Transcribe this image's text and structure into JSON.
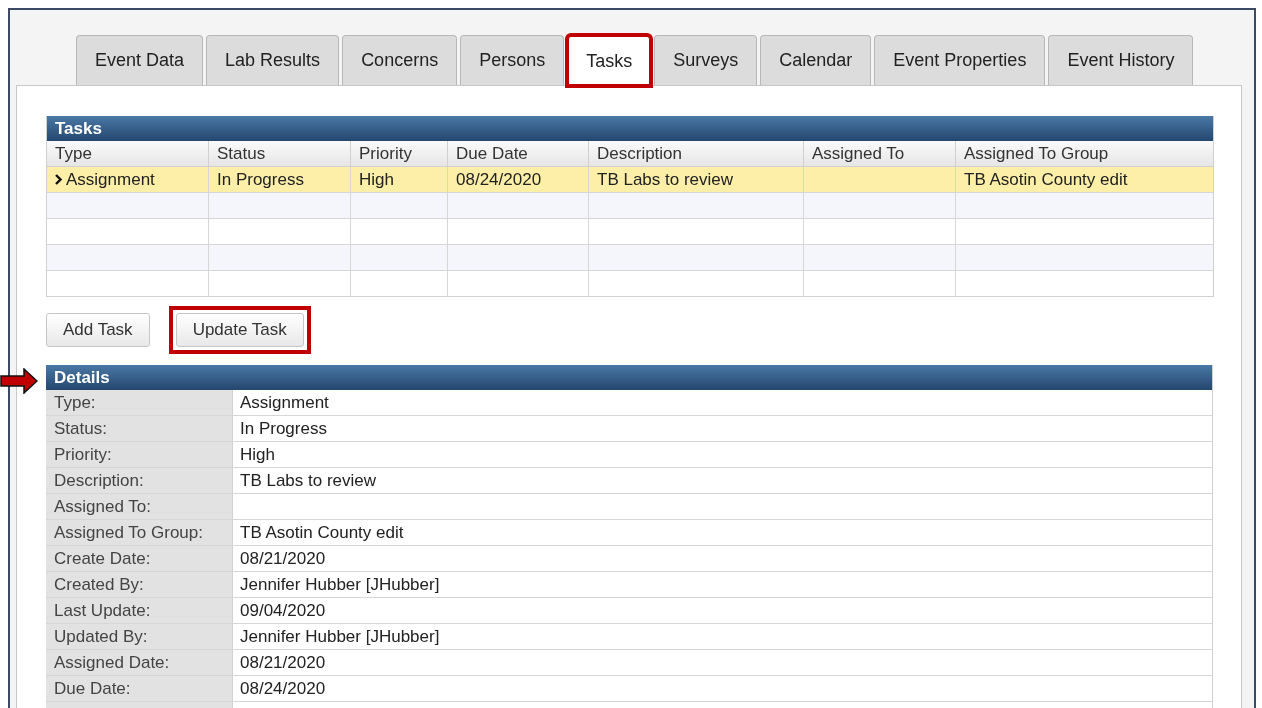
{
  "tabs": [
    {
      "label": "Event Data",
      "selected": false,
      "highlighted": false
    },
    {
      "label": "Lab Results",
      "selected": false,
      "highlighted": false
    },
    {
      "label": "Concerns",
      "selected": false,
      "highlighted": false
    },
    {
      "label": "Persons",
      "selected": false,
      "highlighted": false
    },
    {
      "label": "Tasks",
      "selected": true,
      "highlighted": true
    },
    {
      "label": "Surveys",
      "selected": false,
      "highlighted": false
    },
    {
      "label": "Calendar",
      "selected": false,
      "highlighted": false
    },
    {
      "label": "Event Properties",
      "selected": false,
      "highlighted": false
    },
    {
      "label": "Event History",
      "selected": false,
      "highlighted": false
    }
  ],
  "tasks_table": {
    "title": "Tasks",
    "columns": [
      "Type",
      "Status",
      "Priority",
      "Due Date",
      "Description",
      "Assigned To",
      "Assigned To Group"
    ],
    "rows": [
      {
        "selected": true,
        "cells": [
          "Assignment",
          "In Progress",
          "High",
          "08/24/2020",
          "TB Labs to review",
          "",
          "TB Asotin County edit"
        ]
      }
    ]
  },
  "buttons": [
    {
      "label": "Add Task",
      "highlighted": false
    },
    {
      "label": "Update Task",
      "highlighted": true
    }
  ],
  "details": {
    "title": "Details",
    "pointed": true,
    "rows": [
      {
        "label": "Type:",
        "value": "Assignment"
      },
      {
        "label": "Status:",
        "value": "In Progress"
      },
      {
        "label": "Priority:",
        "value": "High"
      },
      {
        "label": "Description:",
        "value": "TB Labs to review"
      },
      {
        "label": "Assigned To:",
        "value": ""
      },
      {
        "label": "Assigned To Group:",
        "value": "TB Asotin County edit"
      },
      {
        "label": "Create Date:",
        "value": "08/21/2020"
      },
      {
        "label": "Created By:",
        "value": "Jennifer Hubber [JHubber]"
      },
      {
        "label": "Last Update:",
        "value": "09/04/2020"
      },
      {
        "label": "Updated By:",
        "value": "Jennifer Hubber [JHubber]"
      },
      {
        "label": "Assigned Date:",
        "value": "08/21/2020"
      },
      {
        "label": "Due Date:",
        "value": "08/24/2020"
      }
    ]
  }
}
